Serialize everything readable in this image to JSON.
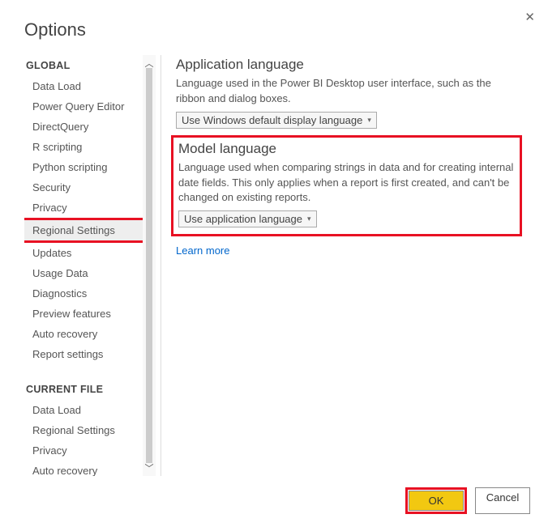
{
  "dialog": {
    "title": "Options"
  },
  "sidebar": {
    "global_header": "GLOBAL",
    "global_items": [
      "Data Load",
      "Power Query Editor",
      "DirectQuery",
      "R scripting",
      "Python scripting",
      "Security",
      "Privacy",
      "Regional Settings",
      "Updates",
      "Usage Data",
      "Diagnostics",
      "Preview features",
      "Auto recovery",
      "Report settings"
    ],
    "current_header": "CURRENT FILE",
    "current_items": [
      "Data Load",
      "Regional Settings",
      "Privacy",
      "Auto recovery"
    ]
  },
  "main": {
    "app_lang_title": "Application language",
    "app_lang_desc": "Language used in the Power BI Desktop user interface, such as the ribbon and dialog boxes.",
    "app_lang_value": "Use Windows default display language",
    "model_lang_title": "Model language",
    "model_lang_desc": "Language used when comparing strings in data and for creating internal date fields. This only applies when a report is first created, and can't be changed on existing reports.",
    "model_lang_value": "Use application language",
    "learn_more": "Learn more"
  },
  "footer": {
    "ok": "OK",
    "cancel": "Cancel"
  }
}
